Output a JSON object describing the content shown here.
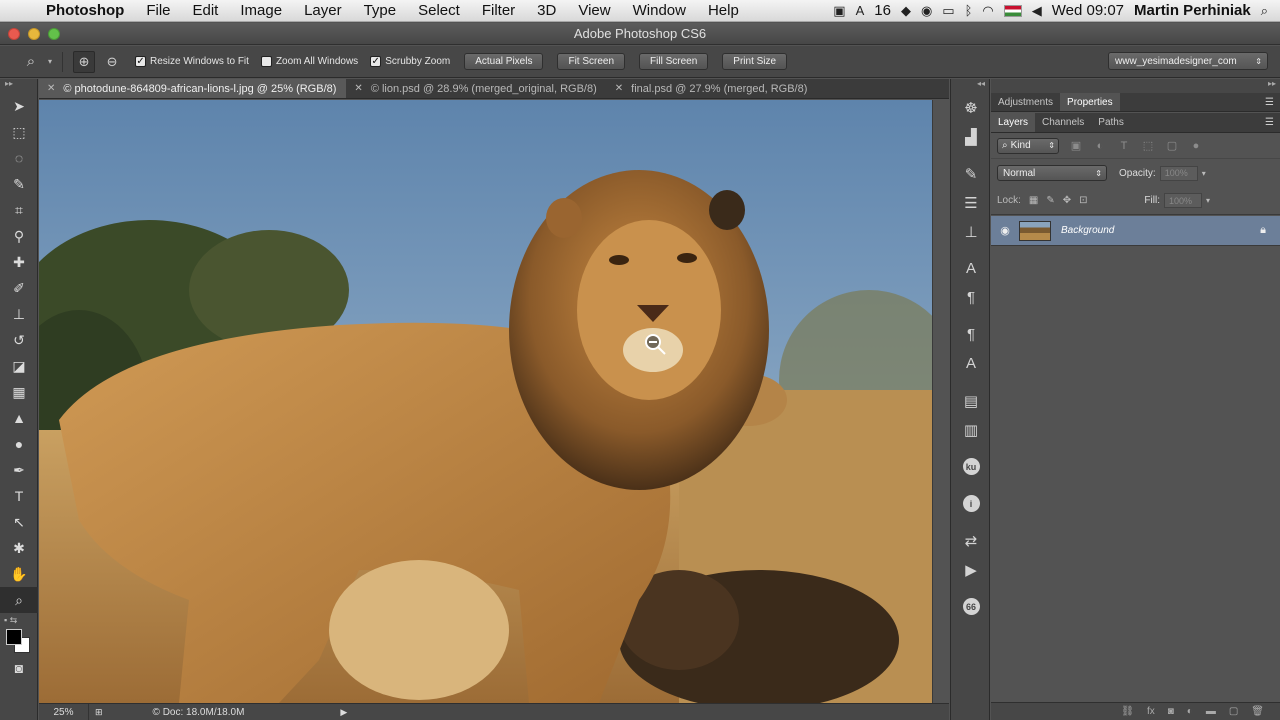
{
  "menubar": {
    "apple_icon": "apple-icon",
    "app_name": "Photoshop",
    "items": [
      "File",
      "Edit",
      "Image",
      "Layer",
      "Type",
      "Select",
      "Filter",
      "3D",
      "View",
      "Window",
      "Help"
    ],
    "status_number": "16",
    "clock": "Wed 09:07",
    "user": "Martin Perhiniak"
  },
  "window": {
    "title": "Adobe Photoshop CS6"
  },
  "options": {
    "resize_windows": "Resize Windows to Fit",
    "zoom_all": "Zoom All Windows",
    "scrubby_zoom": "Scrubby Zoom",
    "actual_pixels": "Actual Pixels",
    "fit_screen": "Fit Screen",
    "fill_screen": "Fill Screen",
    "print_size": "Print Size",
    "workspace": "www_yesimadesigner_com",
    "resize_checked": true,
    "zoom_all_checked": false,
    "scrubby_checked": true
  },
  "doc_tabs": [
    {
      "label": "© photodune-864809-african-lions-l.jpg @ 25% (RGB/8)",
      "active": true
    },
    {
      "label": "© lion.psd @ 28.9% (merged_original, RGB/8)",
      "active": false
    },
    {
      "label": "final.psd @ 27.9% (merged, RGB/8)",
      "active": false
    }
  ],
  "status": {
    "zoom": "25%",
    "doc": "© Doc: 18.0M/18.0M"
  },
  "panels": {
    "top_tabs": [
      "Adjustments",
      "Properties"
    ],
    "layer_tabs": [
      "Layers",
      "Channels",
      "Paths"
    ],
    "kind": "Kind",
    "blend_mode": "Normal",
    "opacity_label": "Opacity:",
    "opacity_value": "100%",
    "lock_label": "Lock:",
    "fill_label": "Fill:",
    "fill_value": "100%",
    "layers": [
      {
        "name": "Background",
        "visible": true,
        "locked": true
      }
    ]
  },
  "colors": {
    "accent_selected_layer": "#6c7f99",
    "panel_bg": "#535353",
    "foreground": "#000000",
    "background": "#ffffff"
  }
}
